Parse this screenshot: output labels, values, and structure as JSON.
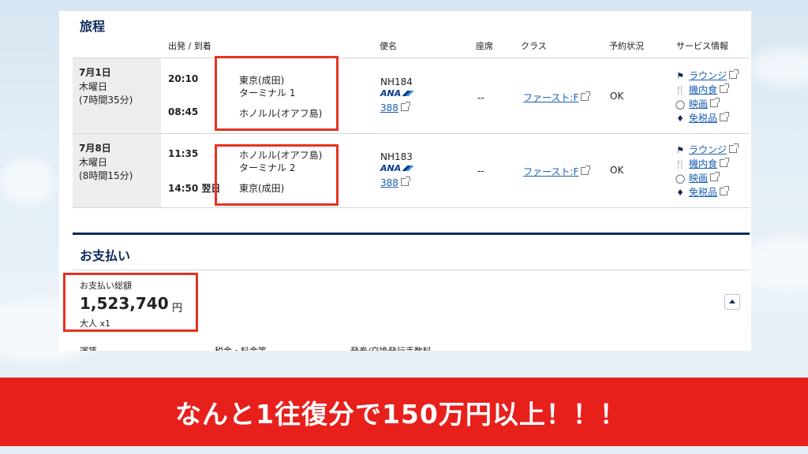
{
  "itinerary": {
    "title": "旅程",
    "headers": {
      "dep_arr": "出発 / 到着",
      "flight": "便名",
      "seat": "座席",
      "class": "クラス",
      "status": "予約状況",
      "service": "サービス情報"
    },
    "flights": [
      {
        "date": "7月1日",
        "weekday": "木曜日",
        "duration": "(7時間35分)",
        "dep_time": "20:10",
        "arr_time": "08:45",
        "dep_place": "東京(成田)",
        "terminal": "ターミナル 1",
        "arr_place": "ホノルル(オアフ島)",
        "flight_no": "NH184",
        "airline_logo": "ANA",
        "aircraft": "388",
        "seat": "--",
        "cabin": "ファースト:F",
        "status": "OK",
        "services": [
          "ラウンジ",
          "機内食",
          "映画",
          "免税品"
        ]
      },
      {
        "date": "7月8日",
        "weekday": "木曜日",
        "duration": "(8時間15分)",
        "dep_time": "11:35",
        "arr_time": "14:50 翌日",
        "dep_place": "ホノルル(オアフ島)",
        "terminal": "ターミナル 2",
        "arr_place": "東京(成田)",
        "flight_no": "NH183",
        "airline_logo": "ANA",
        "aircraft": "388",
        "seat": "--",
        "cabin": "ファースト:F",
        "status": "OK",
        "services": [
          "ラウンジ",
          "機内食",
          "映画",
          "免税品"
        ]
      }
    ],
    "service_icons": [
      "lounge-icon",
      "meal-icon",
      "movie-icon",
      "duty-free-icon"
    ]
  },
  "payment": {
    "title": "お支払い",
    "total_label": "お支払い総額",
    "total_amount": "1,523,740",
    "currency": "円",
    "passengers": "大人 x1",
    "breakdown_headers": [
      "運賃",
      "税金・料金等",
      "発券/交換発行手数料"
    ]
  },
  "banner": {
    "text": "なんと1往復分で150万円以上！！！"
  },
  "colors": {
    "accent_red": "#e8321e",
    "navy": "#0b2a5b",
    "link": "#1a5fb4",
    "banner_bg": "#e8201c"
  }
}
